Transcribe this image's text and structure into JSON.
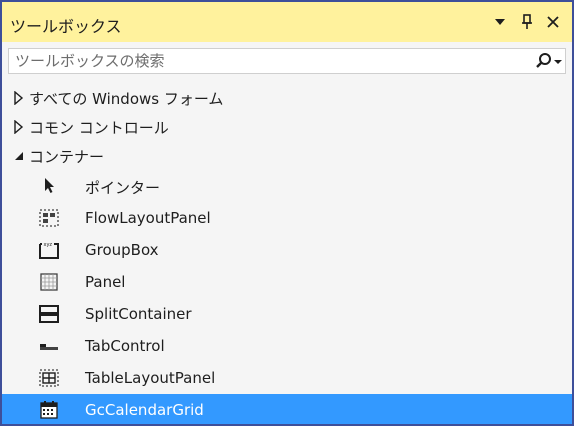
{
  "panel": {
    "title": "ツールボックス",
    "search_placeholder": "ツールボックスの検索"
  },
  "colors": {
    "titlebar_bg": "#fff29d",
    "frame_border": "#3e4f9a",
    "selection_bg": "#3399ff"
  },
  "categories": [
    {
      "label": "すべての Windows フォーム",
      "expanded": false
    },
    {
      "label": "コモン コントロール",
      "expanded": false
    },
    {
      "label": "コンテナー",
      "expanded": true
    }
  ],
  "items": [
    {
      "label": "ポインター",
      "icon": "pointer-icon"
    },
    {
      "label": "FlowLayoutPanel",
      "icon": "flow-layout-panel-icon"
    },
    {
      "label": "GroupBox",
      "icon": "group-box-icon"
    },
    {
      "label": "Panel",
      "icon": "panel-icon"
    },
    {
      "label": "SplitContainer",
      "icon": "split-container-icon"
    },
    {
      "label": "TabControl",
      "icon": "tab-control-icon"
    },
    {
      "label": "TableLayoutPanel",
      "icon": "table-layout-panel-icon"
    },
    {
      "label": "GcCalendarGrid",
      "icon": "calendar-grid-icon",
      "selected": true
    }
  ]
}
